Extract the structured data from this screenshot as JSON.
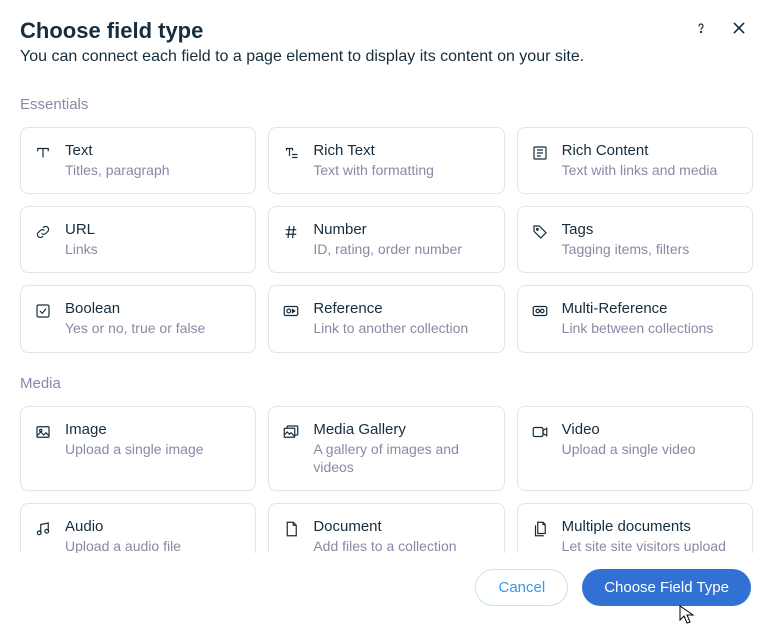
{
  "header": {
    "title": "Choose field type",
    "subtitle": "You can connect each field to a page element to display its content on your site."
  },
  "sections": [
    {
      "key": "essentials",
      "label": "Essentials",
      "items": [
        {
          "key": "text",
          "icon": "text-icon",
          "title": "Text",
          "desc": "Titles, paragraph"
        },
        {
          "key": "richtext",
          "icon": "rich-text-icon",
          "title": "Rich Text",
          "desc": "Text with formatting"
        },
        {
          "key": "richcontent",
          "icon": "rich-content-icon",
          "title": "Rich Content",
          "desc": "Text with links and media"
        },
        {
          "key": "url",
          "icon": "link-icon",
          "title": "URL",
          "desc": "Links"
        },
        {
          "key": "number",
          "icon": "hash-icon",
          "title": "Number",
          "desc": "ID, rating, order number"
        },
        {
          "key": "tags",
          "icon": "tag-icon",
          "title": "Tags",
          "desc": "Tagging items, filters"
        },
        {
          "key": "boolean",
          "icon": "checkbox-icon",
          "title": "Boolean",
          "desc": "Yes or no, true or false"
        },
        {
          "key": "reference",
          "icon": "reference-icon",
          "title": "Reference",
          "desc": "Link to another collection"
        },
        {
          "key": "multireference",
          "icon": "multi-reference-icon",
          "title": "Multi-Reference",
          "desc": "Link between collections"
        }
      ]
    },
    {
      "key": "media",
      "label": "Media",
      "items": [
        {
          "key": "image",
          "icon": "image-icon",
          "title": "Image",
          "desc": "Upload a single image"
        },
        {
          "key": "gallery",
          "icon": "gallery-icon",
          "title": "Media Gallery",
          "desc": "A gallery of images and videos"
        },
        {
          "key": "video",
          "icon": "video-icon",
          "title": "Video",
          "desc": "Upload a single video"
        },
        {
          "key": "audio",
          "icon": "audio-icon",
          "title": "Audio",
          "desc": "Upload a audio file"
        },
        {
          "key": "document",
          "icon": "document-icon",
          "title": "Document",
          "desc": "Add files to a collection"
        },
        {
          "key": "multidoc",
          "icon": "multi-document-icon",
          "title": "Multiple documents",
          "desc": "Let site site visitors upload files to a collection"
        }
      ]
    }
  ],
  "footer": {
    "cancel": "Cancel",
    "submit": "Choose Field Type"
  }
}
